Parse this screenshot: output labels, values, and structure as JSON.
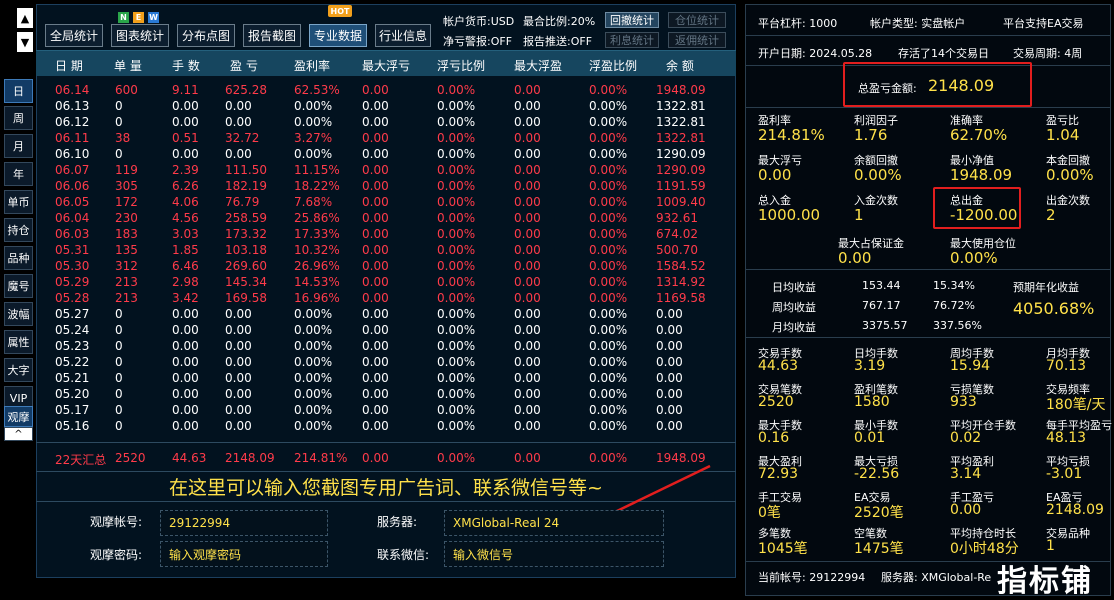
{
  "nav": {
    "up_arrow": "▲",
    "down_arrow": "▼",
    "items": [
      {
        "label": "日",
        "active": true
      },
      {
        "label": "周"
      },
      {
        "label": "月"
      },
      {
        "label": "年"
      },
      {
        "label": "单币"
      },
      {
        "label": "持仓"
      },
      {
        "label": "品种"
      },
      {
        "label": "魔号"
      },
      {
        "label": "波幅"
      },
      {
        "label": "属性"
      },
      {
        "label": "大字"
      },
      {
        "label": "VIP"
      },
      {
        "label": "观摩",
        "active": true
      }
    ],
    "collapse": "^"
  },
  "toolbar": {
    "buttons": [
      "全局统计",
      "图表统计",
      "分布点图",
      "报告截图",
      "专业数据",
      "行业信息"
    ],
    "active": "专业数据",
    "hot_badge": "HOT",
    "new_badge": [
      "N",
      "E",
      "W"
    ],
    "currency": "帐户货币:USD",
    "max_position_ratio": "最合比例:20%",
    "net_loss_alert": "净亏警报:OFF",
    "report_push": "报告推送:OFF",
    "btn_drawdown": "回撤统计",
    "btn_position": "仓位统计",
    "btn_interest": "利息统计",
    "btn_rebate": "返佣统计"
  },
  "table": {
    "headers": [
      "日 期",
      "单 量",
      "手 数",
      "盈 亏",
      "盈利率",
      "最大浮亏",
      "浮亏比例",
      "最大浮盈",
      "浮盈比例",
      "余 额"
    ],
    "rows": [
      {
        "date": "06.14",
        "orders": "600",
        "lots": "9.11",
        "pnl": "625.28",
        "rate": "62.53%",
        "max_float_loss": "0.00",
        "float_loss_pct": "0.00%",
        "max_float_profit": "0.00",
        "float_profit_pct": "0.00%",
        "balance": "1948.09",
        "red": true
      },
      {
        "date": "06.13",
        "orders": "0",
        "lots": "0.00",
        "pnl": "0.00",
        "rate": "0.00%",
        "max_float_loss": "0.00",
        "float_loss_pct": "0.00%",
        "max_float_profit": "0.00",
        "float_profit_pct": "0.00%",
        "balance": "1322.81",
        "red": false
      },
      {
        "date": "06.12",
        "orders": "0",
        "lots": "0.00",
        "pnl": "0.00",
        "rate": "0.00%",
        "max_float_loss": "0.00",
        "float_loss_pct": "0.00%",
        "max_float_profit": "0.00",
        "float_profit_pct": "0.00%",
        "balance": "1322.81",
        "red": false
      },
      {
        "date": "06.11",
        "orders": "38",
        "lots": "0.51",
        "pnl": "32.72",
        "rate": "3.27%",
        "max_float_loss": "0.00",
        "float_loss_pct": "0.00%",
        "max_float_profit": "0.00",
        "float_profit_pct": "0.00%",
        "balance": "1322.81",
        "red": true
      },
      {
        "date": "06.10",
        "orders": "0",
        "lots": "0.00",
        "pnl": "0.00",
        "rate": "0.00%",
        "max_float_loss": "0.00",
        "float_loss_pct": "0.00%",
        "max_float_profit": "0.00",
        "float_profit_pct": "0.00%",
        "balance": "1290.09",
        "red": false
      },
      {
        "date": "06.07",
        "orders": "119",
        "lots": "2.39",
        "pnl": "111.50",
        "rate": "11.15%",
        "max_float_loss": "0.00",
        "float_loss_pct": "0.00%",
        "max_float_profit": "0.00",
        "float_profit_pct": "0.00%",
        "balance": "1290.09",
        "red": true
      },
      {
        "date": "06.06",
        "orders": "305",
        "lots": "6.26",
        "pnl": "182.19",
        "rate": "18.22%",
        "max_float_loss": "0.00",
        "float_loss_pct": "0.00%",
        "max_float_profit": "0.00",
        "float_profit_pct": "0.00%",
        "balance": "1191.59",
        "red": true
      },
      {
        "date": "06.05",
        "orders": "172",
        "lots": "4.06",
        "pnl": "76.79",
        "rate": "7.68%",
        "max_float_loss": "0.00",
        "float_loss_pct": "0.00%",
        "max_float_profit": "0.00",
        "float_profit_pct": "0.00%",
        "balance": "1009.40",
        "red": true
      },
      {
        "date": "06.04",
        "orders": "230",
        "lots": "4.56",
        "pnl": "258.59",
        "rate": "25.86%",
        "max_float_loss": "0.00",
        "float_loss_pct": "0.00%",
        "max_float_profit": "0.00",
        "float_profit_pct": "0.00%",
        "balance": "932.61",
        "red": true
      },
      {
        "date": "06.03",
        "orders": "183",
        "lots": "3.03",
        "pnl": "173.32",
        "rate": "17.33%",
        "max_float_loss": "0.00",
        "float_loss_pct": "0.00%",
        "max_float_profit": "0.00",
        "float_profit_pct": "0.00%",
        "balance": "674.02",
        "red": true
      },
      {
        "date": "05.31",
        "orders": "135",
        "lots": "1.85",
        "pnl": "103.18",
        "rate": "10.32%",
        "max_float_loss": "0.00",
        "float_loss_pct": "0.00%",
        "max_float_profit": "0.00",
        "float_profit_pct": "0.00%",
        "balance": "500.70",
        "red": true
      },
      {
        "date": "05.30",
        "orders": "312",
        "lots": "6.46",
        "pnl": "269.60",
        "rate": "26.96%",
        "max_float_loss": "0.00",
        "float_loss_pct": "0.00%",
        "max_float_profit": "0.00",
        "float_profit_pct": "0.00%",
        "balance": "1584.52",
        "red": true
      },
      {
        "date": "05.29",
        "orders": "213",
        "lots": "2.98",
        "pnl": "145.34",
        "rate": "14.53%",
        "max_float_loss": "0.00",
        "float_loss_pct": "0.00%",
        "max_float_profit": "0.00",
        "float_profit_pct": "0.00%",
        "balance": "1314.92",
        "red": true
      },
      {
        "date": "05.28",
        "orders": "213",
        "lots": "3.42",
        "pnl": "169.58",
        "rate": "16.96%",
        "max_float_loss": "0.00",
        "float_loss_pct": "0.00%",
        "max_float_profit": "0.00",
        "float_profit_pct": "0.00%",
        "balance": "1169.58",
        "red": true
      },
      {
        "date": "05.27",
        "orders": "0",
        "lots": "0.00",
        "pnl": "0.00",
        "rate": "0.00%",
        "max_float_loss": "0.00",
        "float_loss_pct": "0.00%",
        "max_float_profit": "0.00",
        "float_profit_pct": "0.00%",
        "balance": "0.00",
        "red": false
      },
      {
        "date": "05.24",
        "orders": "0",
        "lots": "0.00",
        "pnl": "0.00",
        "rate": "0.00%",
        "max_float_loss": "0.00",
        "float_loss_pct": "0.00%",
        "max_float_profit": "0.00",
        "float_profit_pct": "0.00%",
        "balance": "0.00",
        "red": false
      },
      {
        "date": "05.23",
        "orders": "0",
        "lots": "0.00",
        "pnl": "0.00",
        "rate": "0.00%",
        "max_float_loss": "0.00",
        "float_loss_pct": "0.00%",
        "max_float_profit": "0.00",
        "float_profit_pct": "0.00%",
        "balance": "0.00",
        "red": false
      },
      {
        "date": "05.22",
        "orders": "0",
        "lots": "0.00",
        "pnl": "0.00",
        "rate": "0.00%",
        "max_float_loss": "0.00",
        "float_loss_pct": "0.00%",
        "max_float_profit": "0.00",
        "float_profit_pct": "0.00%",
        "balance": "0.00",
        "red": false
      },
      {
        "date": "05.21",
        "orders": "0",
        "lots": "0.00",
        "pnl": "0.00",
        "rate": "0.00%",
        "max_float_loss": "0.00",
        "float_loss_pct": "0.00%",
        "max_float_profit": "0.00",
        "float_profit_pct": "0.00%",
        "balance": "0.00",
        "red": false
      },
      {
        "date": "05.20",
        "orders": "0",
        "lots": "0.00",
        "pnl": "0.00",
        "rate": "0.00%",
        "max_float_loss": "0.00",
        "float_loss_pct": "0.00%",
        "max_float_profit": "0.00",
        "float_profit_pct": "0.00%",
        "balance": "0.00",
        "red": false
      },
      {
        "date": "05.17",
        "orders": "0",
        "lots": "0.00",
        "pnl": "0.00",
        "rate": "0.00%",
        "max_float_loss": "0.00",
        "float_loss_pct": "0.00%",
        "max_float_profit": "0.00",
        "float_profit_pct": "0.00%",
        "balance": "0.00",
        "red": false
      },
      {
        "date": "05.16",
        "orders": "0",
        "lots": "0.00",
        "pnl": "0.00",
        "rate": "0.00%",
        "max_float_loss": "0.00",
        "float_loss_pct": "0.00%",
        "max_float_profit": "0.00",
        "float_profit_pct": "0.00%",
        "balance": "0.00",
        "red": false
      }
    ],
    "total": {
      "date": "22天汇总",
      "orders": "2520",
      "lots": "44.63",
      "pnl": "2148.09",
      "rate": "214.81%",
      "max_float_loss": "0.00",
      "float_loss_pct": "0.00%",
      "max_float_profit": "0.00",
      "float_profit_pct": "0.00%",
      "balance": "1948.09"
    }
  },
  "ad_text": "在这里可以输入您截图专用广告词、联系微信号等~",
  "form": {
    "account_label": "观摩帐号:",
    "account_value": "29122994",
    "password_label": "观摩密码:",
    "password_placeholder": "输入观摩密码",
    "server_label": "服务器:",
    "server_value": "XMGlobal-Real 24",
    "wechat_label": "联系微信:",
    "wechat_placeholder": "输入微信号"
  },
  "right": {
    "leverage": "平台杠杆:  1000",
    "account_type": "帐户类型:  实盘帐户",
    "ea_support": "平台支持EA交易",
    "open_date": "开户日期:  2024.05.28",
    "survival": "存活了14个交易日",
    "cycle": "交易周期:  4周",
    "total_pnl_label": "总盈亏金额:",
    "total_pnl_value": "2148.09",
    "grid1": [
      {
        "label": "盈利率",
        "value": "214.81%"
      },
      {
        "label": "利润因子",
        "value": "1.76"
      },
      {
        "label": "准确率",
        "value": "62.70%"
      },
      {
        "label": "盈亏比",
        "value": "1.04"
      },
      {
        "label": "最大浮亏",
        "value": "0.00"
      },
      {
        "label": "余额回撤",
        "value": "0.00%"
      },
      {
        "label": "最小净值",
        "value": "1948.09"
      },
      {
        "label": "本金回撤",
        "value": "0.00%"
      },
      {
        "label": "总入金",
        "value": "1000.00"
      },
      {
        "label": "入金次数",
        "value": "1"
      },
      {
        "label": "总出金",
        "value": "-1200.00"
      },
      {
        "label": "出金次数",
        "value": "2"
      }
    ],
    "margin_max_label": "最大占保证金",
    "margin_max_value": "0.00",
    "max_pos_label": "最大使用仓位",
    "max_pos_value": "0.00%",
    "income": [
      {
        "label": "日均收益",
        "amount": "153.44",
        "pct": "15.34%"
      },
      {
        "label": "周均收益",
        "amount": "767.17",
        "pct": "76.72%"
      },
      {
        "label": "月均收益",
        "amount": "3375.57",
        "pct": "337.56%"
      }
    ],
    "annual_label": "预期年化收益",
    "annual_value": "4050.68%",
    "grid2": [
      {
        "label": "交易手数",
        "value": "44.63"
      },
      {
        "label": "日均手数",
        "value": "3.19"
      },
      {
        "label": "周均手数",
        "value": "15.94"
      },
      {
        "label": "月均手数",
        "value": "70.13"
      },
      {
        "label": "交易笔数",
        "value": "2520"
      },
      {
        "label": "盈利笔数",
        "value": "1580"
      },
      {
        "label": "亏损笔数",
        "value": "933"
      },
      {
        "label": "交易频率",
        "value": "180笔/天"
      },
      {
        "label": "最大手数",
        "value": "0.16"
      },
      {
        "label": "最小手数",
        "value": "0.01"
      },
      {
        "label": "平均开仓手数",
        "value": "0.02"
      },
      {
        "label": "每手平均盈亏",
        "value": "48.13"
      },
      {
        "label": "最大盈利",
        "value": "72.93"
      },
      {
        "label": "最大亏损",
        "value": "-22.56"
      },
      {
        "label": "平均盈利",
        "value": "3.14"
      },
      {
        "label": "平均亏损",
        "value": "-3.01"
      },
      {
        "label": "手工交易",
        "value": "0笔"
      },
      {
        "label": "EA交易",
        "value": "2520笔"
      },
      {
        "label": "手工盈亏",
        "value": "0.00"
      },
      {
        "label": "EA盈亏",
        "value": "2148.09"
      },
      {
        "label": "多笔数",
        "value": "1045笔"
      },
      {
        "label": "空笔数",
        "value": "1475笔"
      },
      {
        "label": "平均持仓时长",
        "value": "0小时48分"
      },
      {
        "label": "交易品种",
        "value": "1"
      }
    ],
    "footer_account": "当前帐号:  29122994",
    "footer_server": "服务器:  XMGlobal-Re",
    "watermark": "指标铺"
  },
  "colors": {
    "accent_yellow": "#ffe14a",
    "loss_red": "#ff3b4a",
    "header_blue": "#16465f",
    "highlight_box": "#e21e1e"
  }
}
